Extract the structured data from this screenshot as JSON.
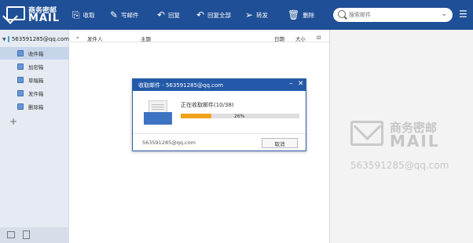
{
  "app": {
    "logo_line1": "商务密邮",
    "logo_line2": "MAIL"
  },
  "toolbar": {
    "receive": "收取",
    "compose": "写邮件",
    "reply": "回复",
    "reply_all": "回复全部",
    "forward": "转发",
    "delete": "删除"
  },
  "search": {
    "placeholder": "搜索邮件"
  },
  "sidebar": {
    "account": "563591285@qq.com",
    "folders": [
      {
        "label": "收件箱",
        "active": true
      },
      {
        "label": "加密箱"
      },
      {
        "label": "草稿箱"
      },
      {
        "label": "发件箱"
      },
      {
        "label": "删除箱"
      }
    ]
  },
  "list": {
    "headers": {
      "sender": "发件人",
      "subject": "主题",
      "date": "日期",
      "size": "大小"
    }
  },
  "dialog": {
    "title": "收取邮件 - 563591285@qq.com",
    "status": "正在收取邮件(10/38)",
    "progress_label": "26%",
    "progress": 0.26,
    "account": "563591285@qq.com",
    "cancel": "取消"
  },
  "preview": {
    "watermark_line1": "商务密邮",
    "watermark_line2": "MAIL",
    "watermark_email": "563591285@qq.com"
  },
  "colors": {
    "toolbar_bg": "#1f4f96",
    "dialog_title_bg": "#2359a8",
    "progress_fill": "#f0a21f"
  }
}
